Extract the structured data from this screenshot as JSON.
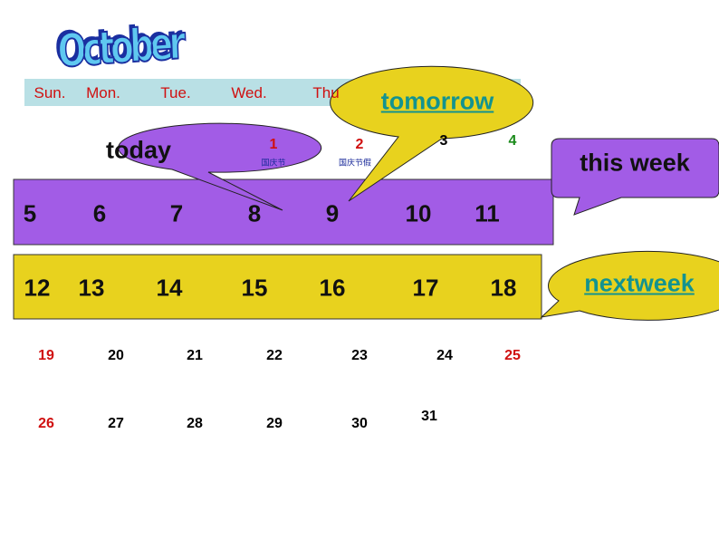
{
  "title": "October",
  "colors": {
    "purple": "#a25ce6",
    "yellow": "#e8d21e",
    "header": "#b9e0e5",
    "red": "#d01010",
    "green": "#1a8a1a",
    "teal": "#13938f"
  },
  "weekdays": [
    "Sun.",
    "Mon.",
    "Tue.",
    "Wed.",
    "Thu"
  ],
  "row1": {
    "days": [
      "1",
      "2",
      "3",
      "4"
    ],
    "notes": [
      "国庆节",
      "国庆节假"
    ]
  },
  "this_week": [
    "5",
    "6",
    "7",
    "8",
    "9",
    "10",
    "11"
  ],
  "next_week": [
    "12",
    "13",
    "14",
    "15",
    "16",
    "17",
    "18"
  ],
  "row4": [
    "19",
    "20",
    "21",
    "22",
    "23",
    "24",
    "25"
  ],
  "row5": [
    "26",
    "27",
    "28",
    "29",
    "30",
    "31"
  ],
  "callouts": {
    "today": "today",
    "tomorrow": "tomorrow",
    "this_week": "this week",
    "next_week": "nextweek"
  }
}
